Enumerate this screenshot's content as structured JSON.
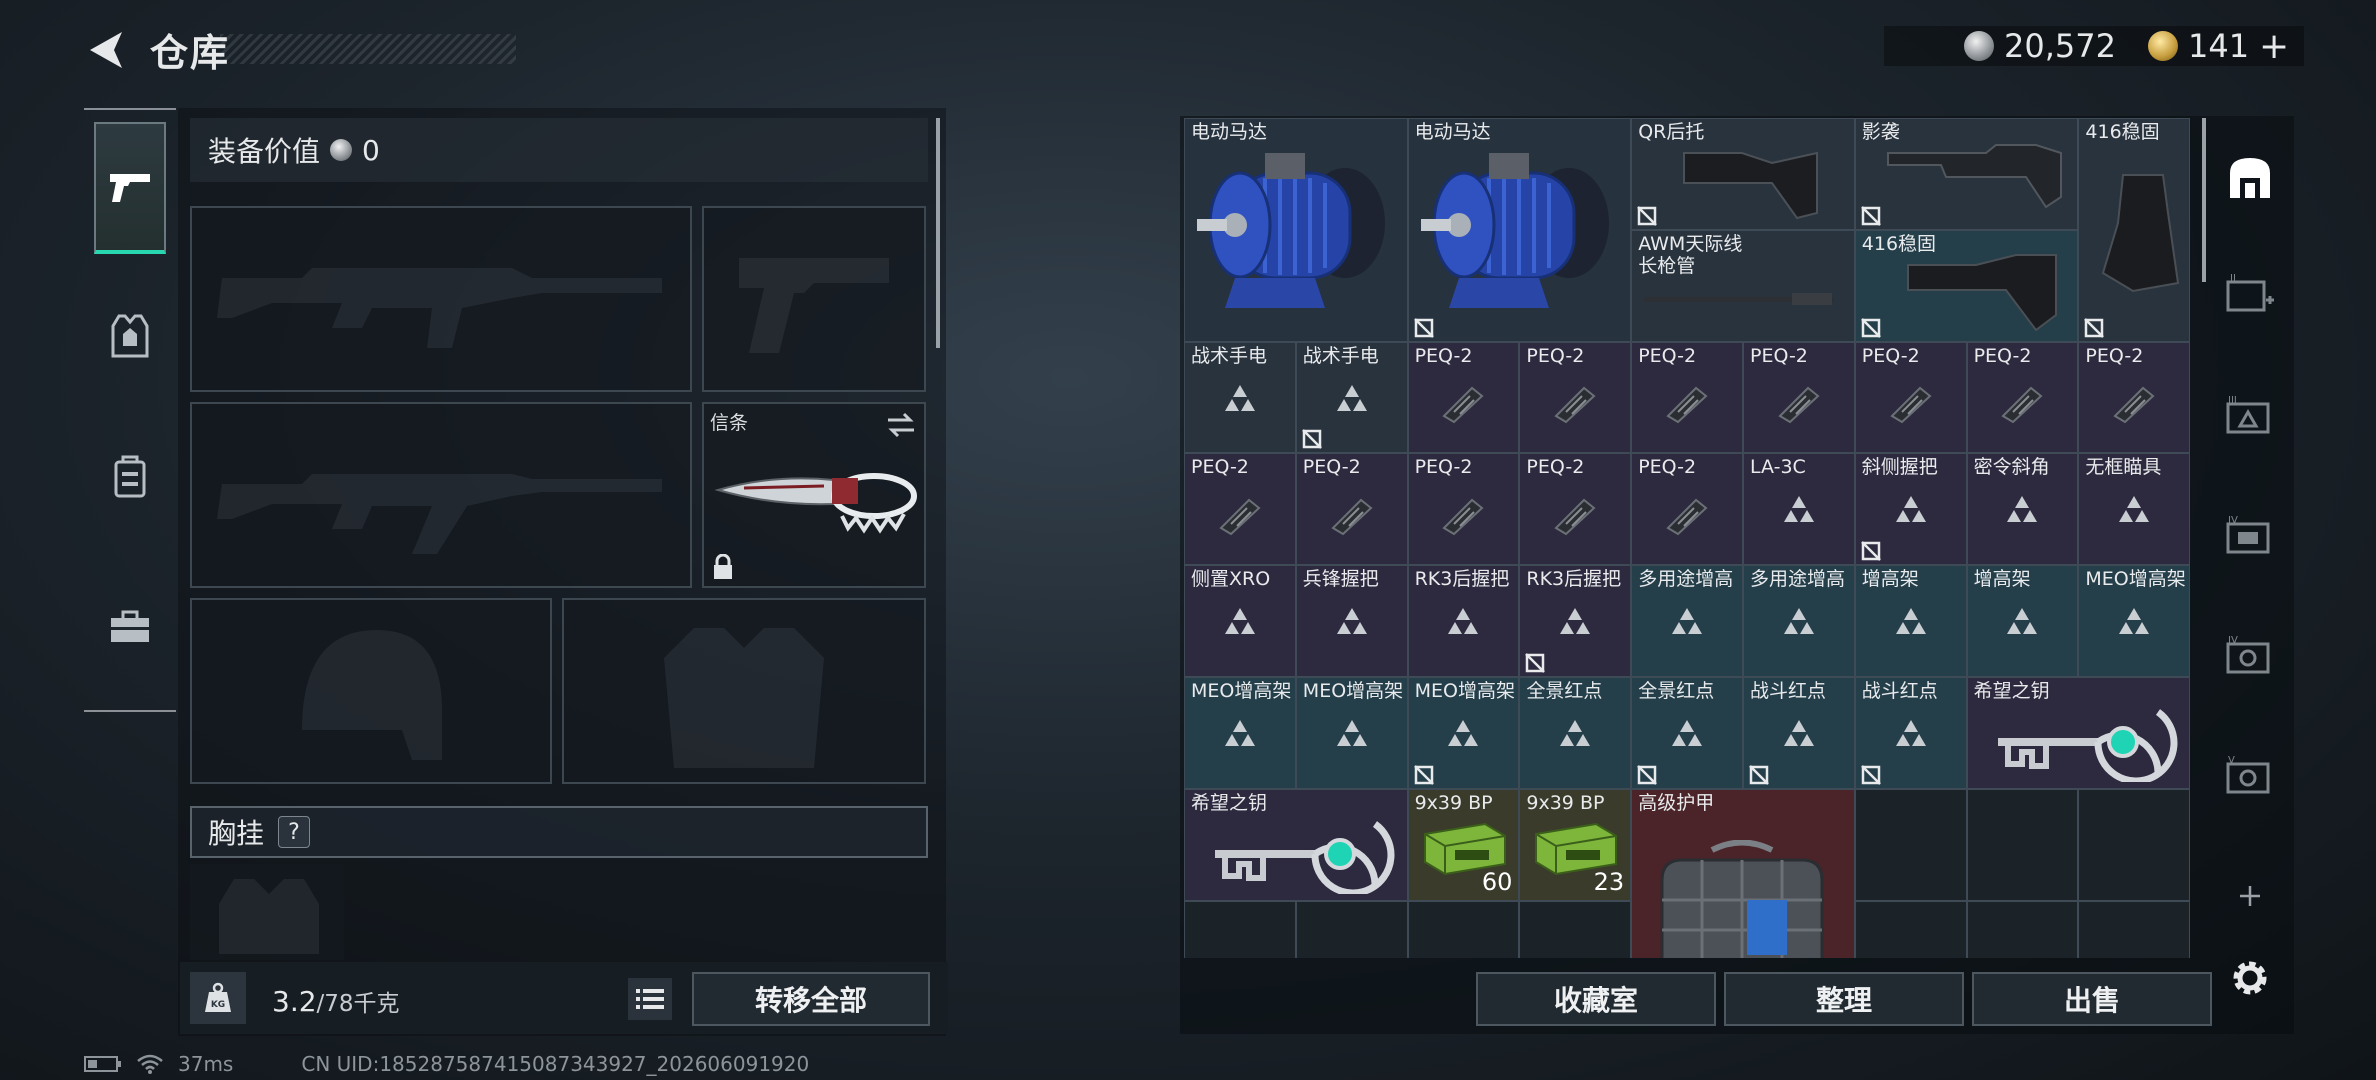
{
  "header": {
    "title": "仓库",
    "currency_silver": "20,572",
    "currency_gold": "141",
    "gold_add": "+"
  },
  "rail": {
    "items": [
      {
        "icon": "pistol-icon",
        "active": true
      },
      {
        "icon": "armor-icon"
      },
      {
        "icon": "backpack-icon"
      },
      {
        "icon": "toolbox-icon"
      }
    ]
  },
  "equip": {
    "value_label": "装备价值",
    "value": "0",
    "melee_label": "信条",
    "chest_label": "胸挂",
    "chest_help": "?"
  },
  "bottom": {
    "weight": "3.2",
    "weight_max": "/78千克",
    "transfer_all": "转移全部",
    "vault": "收藏室",
    "organize": "整理",
    "sell": "出售"
  },
  "status": {
    "ping": "37ms",
    "uid": "CN UID:185287587415087343927_202606091920"
  },
  "storage": {
    "items": [
      {
        "name": "电动马达",
        "type": "motor",
        "tint": "t-blue",
        "c": 0,
        "r": 0,
        "w": 2,
        "h": 2,
        "lock": false
      },
      {
        "name": "电动马达",
        "type": "motor",
        "tint": "t-blue",
        "c": 2,
        "r": 0,
        "w": 2,
        "h": 2,
        "lock": true
      },
      {
        "name": "QR后托",
        "type": "stock",
        "tint": "t-slate",
        "c": 4,
        "r": 0,
        "w": 2,
        "h": 1,
        "lock": true
      },
      {
        "name": "影袭",
        "type": "stock2",
        "tint": "t-slate",
        "c": 6,
        "r": 0,
        "w": 2,
        "h": 1,
        "lock": true
      },
      {
        "name": "416稳固",
        "type": "grip",
        "tint": "t-slate",
        "c": 8,
        "r": 0,
        "w": 1,
        "h": 2,
        "lock": true
      },
      {
        "name": "AWM天际线\n长枪管",
        "type": "barrel",
        "tint": "t-slate",
        "c": 4,
        "r": 1,
        "w": 2,
        "h": 1,
        "lock": false
      },
      {
        "name": "416稳固",
        "type": "stock3",
        "tint": "t-teal",
        "c": 6,
        "r": 1,
        "w": 2,
        "h": 1,
        "lock": true
      },
      {
        "name": "战术手电",
        "type": "tri",
        "tint": "t-slate",
        "c": 0,
        "r": 2,
        "w": 1,
        "h": 1,
        "lock": false
      },
      {
        "name": "战术手电",
        "type": "tri",
        "tint": "t-slate",
        "c": 1,
        "r": 2,
        "w": 1,
        "h": 1,
        "lock": true
      },
      {
        "name": "PEQ-2",
        "type": "peq",
        "tint": "t-purple",
        "c": 2,
        "r": 2,
        "w": 1,
        "h": 1,
        "lock": false
      },
      {
        "name": "PEQ-2",
        "type": "peq",
        "tint": "t-purple",
        "c": 3,
        "r": 2,
        "w": 1,
        "h": 1,
        "lock": false
      },
      {
        "name": "PEQ-2",
        "type": "peq",
        "tint": "t-purple",
        "c": 4,
        "r": 2,
        "w": 1,
        "h": 1,
        "lock": false
      },
      {
        "name": "PEQ-2",
        "type": "peq",
        "tint": "t-purple",
        "c": 5,
        "r": 2,
        "w": 1,
        "h": 1,
        "lock": false
      },
      {
        "name": "PEQ-2",
        "type": "peq",
        "tint": "t-purple",
        "c": 6,
        "r": 2,
        "w": 1,
        "h": 1,
        "lock": false
      },
      {
        "name": "PEQ-2",
        "type": "peq",
        "tint": "t-purple",
        "c": 7,
        "r": 2,
        "w": 1,
        "h": 1,
        "lock": false
      },
      {
        "name": "PEQ-2",
        "type": "peq",
        "tint": "t-purple",
        "c": 8,
        "r": 2,
        "w": 1,
        "h": 1,
        "lock": false
      },
      {
        "name": "PEQ-2",
        "type": "peq",
        "tint": "t-purple",
        "c": 0,
        "r": 3,
        "w": 1,
        "h": 1,
        "lock": false
      },
      {
        "name": "PEQ-2",
        "type": "peq",
        "tint": "t-purple",
        "c": 1,
        "r": 3,
        "w": 1,
        "h": 1,
        "lock": false
      },
      {
        "name": "PEQ-2",
        "type": "peq",
        "tint": "t-purple",
        "c": 2,
        "r": 3,
        "w": 1,
        "h": 1,
        "lock": false
      },
      {
        "name": "PEQ-2",
        "type": "peq",
        "tint": "t-purple",
        "c": 3,
        "r": 3,
        "w": 1,
        "h": 1,
        "lock": false
      },
      {
        "name": "PEQ-2",
        "type": "peq",
        "tint": "t-purple",
        "c": 4,
        "r": 3,
        "w": 1,
        "h": 1,
        "lock": false
      },
      {
        "name": "LA-3C",
        "type": "tri",
        "tint": "t-purple",
        "c": 5,
        "r": 3,
        "w": 1,
        "h": 1,
        "lock": false
      },
      {
        "name": "斜侧握把",
        "type": "tri",
        "tint": "t-purple",
        "c": 6,
        "r": 3,
        "w": 1,
        "h": 1,
        "lock": true
      },
      {
        "name": "密令斜角",
        "type": "tri",
        "tint": "t-purple",
        "c": 7,
        "r": 3,
        "w": 1,
        "h": 1,
        "lock": false
      },
      {
        "name": "无框瞄具",
        "type": "tri",
        "tint": "t-purple",
        "c": 8,
        "r": 3,
        "w": 1,
        "h": 1,
        "lock": false
      },
      {
        "name": "侧置XRO",
        "type": "tri",
        "tint": "t-purple",
        "c": 0,
        "r": 4,
        "w": 1,
        "h": 1,
        "lock": false
      },
      {
        "name": "兵锋握把",
        "type": "tri",
        "tint": "t-purple",
        "c": 1,
        "r": 4,
        "w": 1,
        "h": 1,
        "lock": false
      },
      {
        "name": "RK3后握把",
        "type": "tri",
        "tint": "t-purple",
        "c": 2,
        "r": 4,
        "w": 1,
        "h": 1,
        "lock": false
      },
      {
        "name": "RK3后握把",
        "type": "tri",
        "tint": "t-purple",
        "c": 3,
        "r": 4,
        "w": 1,
        "h": 1,
        "lock": true
      },
      {
        "name": "多用途增高",
        "type": "tri",
        "tint": "t-teal",
        "c": 4,
        "r": 4,
        "w": 1,
        "h": 1,
        "lock": false
      },
      {
        "name": "多用途增高",
        "type": "tri",
        "tint": "t-teal",
        "c": 5,
        "r": 4,
        "w": 1,
        "h": 1,
        "lock": false
      },
      {
        "name": "增高架",
        "type": "tri",
        "tint": "t-teal",
        "c": 6,
        "r": 4,
        "w": 1,
        "h": 1,
        "lock": false
      },
      {
        "name": "增高架",
        "type": "tri",
        "tint": "t-teal",
        "c": 7,
        "r": 4,
        "w": 1,
        "h": 1,
        "lock": false
      },
      {
        "name": "MEO增高架",
        "type": "tri",
        "tint": "t-teal",
        "c": 8,
        "r": 4,
        "w": 1,
        "h": 1,
        "lock": false
      },
      {
        "name": "MEO增高架",
        "type": "tri",
        "tint": "t-teal",
        "c": 0,
        "r": 5,
        "w": 1,
        "h": 1,
        "lock": false
      },
      {
        "name": "MEO增高架",
        "type": "tri",
        "tint": "t-teal",
        "c": 1,
        "r": 5,
        "w": 1,
        "h": 1,
        "lock": false
      },
      {
        "name": "MEO增高架",
        "type": "tri",
        "tint": "t-teal",
        "c": 2,
        "r": 5,
        "w": 1,
        "h": 1,
        "lock": true
      },
      {
        "name": "全景红点",
        "type": "tri",
        "tint": "t-teal",
        "c": 3,
        "r": 5,
        "w": 1,
        "h": 1,
        "lock": false
      },
      {
        "name": "全景红点",
        "type": "tri",
        "tint": "t-teal",
        "c": 4,
        "r": 5,
        "w": 1,
        "h": 1,
        "lock": true
      },
      {
        "name": "战斗红点",
        "type": "tri",
        "tint": "t-teal",
        "c": 5,
        "r": 5,
        "w": 1,
        "h": 1,
        "lock": true
      },
      {
        "name": "战斗红点",
        "type": "tri",
        "tint": "t-teal",
        "c": 6,
        "r": 5,
        "w": 1,
        "h": 1,
        "lock": true
      },
      {
        "name": "希望之钥",
        "type": "key",
        "tint": "t-purple",
        "c": 7,
        "r": 5,
        "w": 2,
        "h": 1,
        "lock": false
      },
      {
        "name": "希望之钥",
        "type": "key",
        "tint": "t-purple",
        "c": 0,
        "r": 6,
        "w": 2,
        "h": 1,
        "lock": false
      },
      {
        "name": "9x39 BP",
        "type": "ammo",
        "tint": "t-olive",
        "c": 2,
        "r": 6,
        "w": 1,
        "h": 1,
        "lock": false,
        "qty": "60"
      },
      {
        "name": "9x39 BP",
        "type": "ammo",
        "tint": "t-olive",
        "c": 3,
        "r": 6,
        "w": 1,
        "h": 1,
        "lock": false,
        "qty": "23"
      },
      {
        "name": "高级护甲",
        "type": "armor",
        "tint": "t-red",
        "c": 4,
        "r": 6,
        "w": 2,
        "h": 2,
        "lock": false
      }
    ]
  }
}
